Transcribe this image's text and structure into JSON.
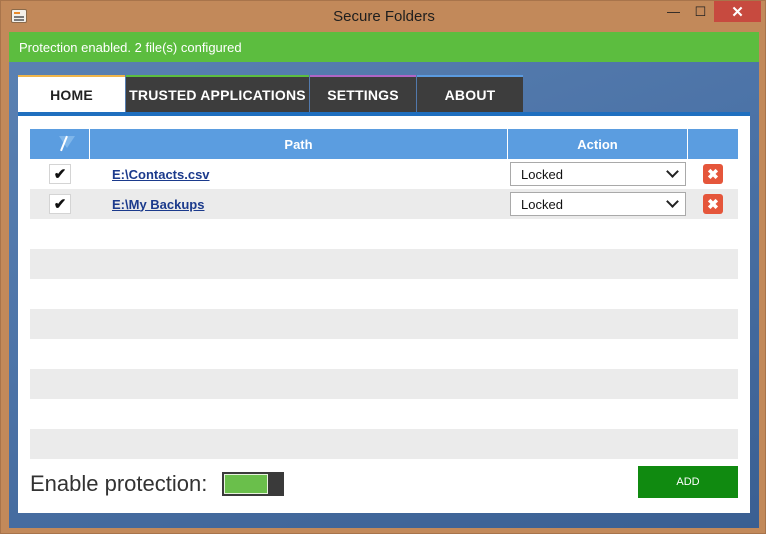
{
  "window": {
    "title": "Secure Folders"
  },
  "status": {
    "text": "Protection enabled. 2 file(s) configured"
  },
  "tabs": [
    {
      "label": "HOME",
      "active": true
    },
    {
      "label": "TRUSTED APPLICATIONS",
      "active": false
    },
    {
      "label": "SETTINGS",
      "active": false
    },
    {
      "label": "ABOUT",
      "active": false
    }
  ],
  "grid": {
    "columns": {
      "path": "Path",
      "action": "Action"
    },
    "rows": [
      {
        "checked": true,
        "check_glyph": "✔",
        "path": "E:\\Contacts.csv",
        "action": "Locked"
      },
      {
        "checked": true,
        "check_glyph": "✔",
        "path": "E:\\My Backups",
        "action": "Locked"
      }
    ],
    "delete_glyph": "✖"
  },
  "footer": {
    "enable_label": "Enable protection:",
    "protection_enabled": true,
    "toggle_fill": 0.75,
    "add_label": "ADD"
  },
  "colors": {
    "status_bar": "#5cbd3f",
    "header": "#5b9de0",
    "add_button": "#108a10",
    "delete": "#e5563b",
    "toggle_on": "#6abf4b"
  }
}
